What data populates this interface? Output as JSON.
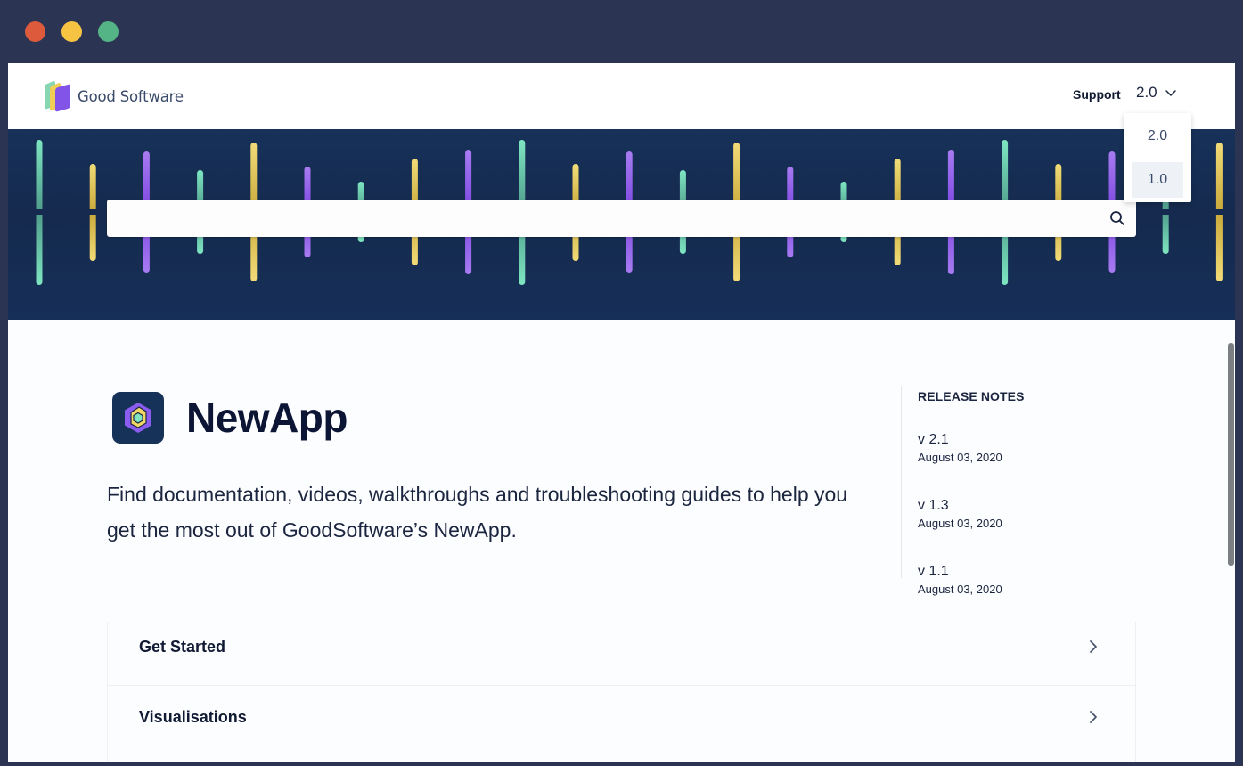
{
  "window": {
    "controls": [
      "close",
      "minimize",
      "maximize"
    ]
  },
  "header": {
    "brand_name": "Good Software",
    "brand_icon": "stacked-cards-logo-icon",
    "support_label": "Support",
    "version_selected": "2.0",
    "version_options": [
      "2.0",
      "1.0"
    ],
    "version_hovered": "1.0"
  },
  "search": {
    "value": "",
    "placeholder": "",
    "icon": "search-icon"
  },
  "app": {
    "icon": "hexagon-app-icon",
    "title": "NewApp",
    "description": "Find documentation, videos, walkthroughs and troubleshooting guides to help you get the most out of GoodSoftware’s NewApp."
  },
  "release_notes": {
    "heading": "RELEASE NOTES",
    "items": [
      {
        "version": "v 2.1",
        "date": "August 03, 2020"
      },
      {
        "version": "v 1.3",
        "date": "August 03, 2020"
      },
      {
        "version": "v 1.1",
        "date": "August 03, 2020"
      }
    ]
  },
  "sections": [
    {
      "label": "Get Started",
      "icon": "chevron-right-icon"
    },
    {
      "label": "Visualisations",
      "icon": "chevron-right-icon"
    }
  ],
  "colors": {
    "frame": "#2c3454",
    "hero_bg": "#162f58",
    "bar_teal": "#7ee6c1",
    "bar_yellow": "#f2dc78",
    "bar_purple": "#a87bf2",
    "text_dark": "#0d1535"
  }
}
